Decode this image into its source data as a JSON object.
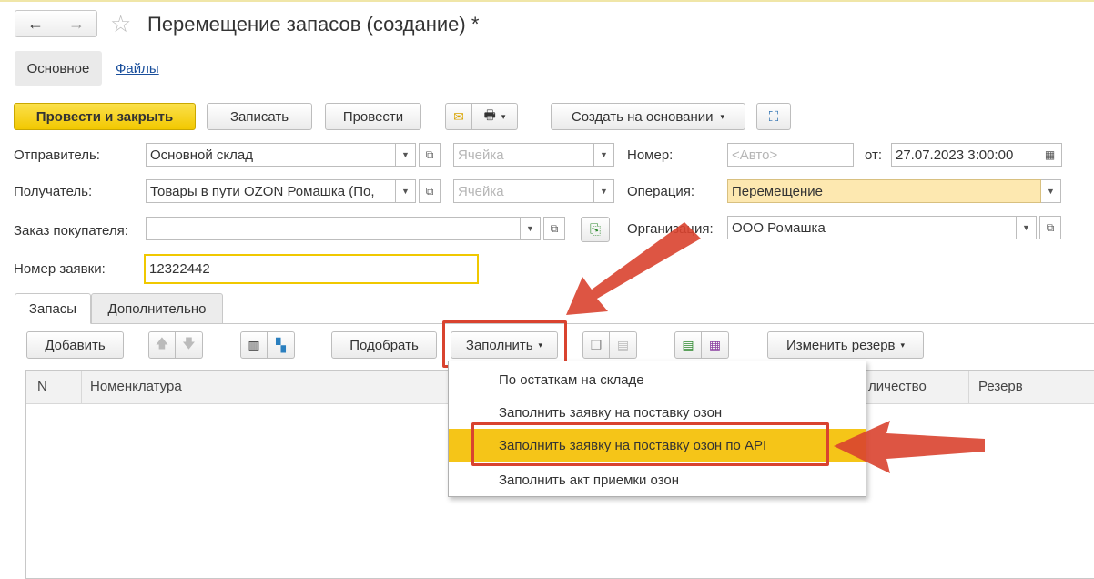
{
  "header": {
    "title": "Перемещение запасов (создание) *",
    "back_icon": "←",
    "forward_icon": "→",
    "star_icon": "☆"
  },
  "page_tabs": {
    "main": "Основное",
    "files": "Файлы"
  },
  "toolbar": {
    "post_close": "Провести и закрыть",
    "save": "Записать",
    "post": "Провести",
    "create_based": "Создать на основании",
    "mail_icon": "✉",
    "print_icon": "🖶",
    "struct_icon": "⛶"
  },
  "form": {
    "sender_label": "Отправитель:",
    "sender_value": "Основной склад",
    "cell_placeholder": "Ячейка",
    "receiver_label": "Получатель:",
    "receiver_value": "Товары в пути OZON Ромашка (По,",
    "order_label": "Заказ покупателя:",
    "order_value": "",
    "number_label": "Номер:",
    "number_placeholder": "<Авто>",
    "date_label": "от:",
    "date_value": "27.07.2023  3:00:00",
    "operation_label": "Операция:",
    "operation_value": "Перемещение",
    "org_label": "Организация:",
    "org_value": "ООО Ромашка",
    "request_label": "Номер заявки:",
    "request_value": "12322442"
  },
  "inner_tabs": {
    "stock": "Запасы",
    "extra": "Дополнительно"
  },
  "table_toolbar": {
    "add": "Добавить",
    "pick": "Подобрать",
    "fill": "Заполнить",
    "change_reserve": "Изменить резерв",
    "up_icon": "🡅",
    "down_icon": "🡇"
  },
  "table": {
    "columns": [
      "N",
      "Номенклатура",
      "личество",
      "Резерв"
    ]
  },
  "fill_menu": {
    "items": [
      "По остаткам на складе",
      "Заполнить заявку на поставку озон",
      "Заполнить заявку на поставку озон по API",
      "Заполнить акт приемки озон"
    ]
  },
  "colors": {
    "accent": "#f5c518",
    "annotation": "#d9432f"
  }
}
